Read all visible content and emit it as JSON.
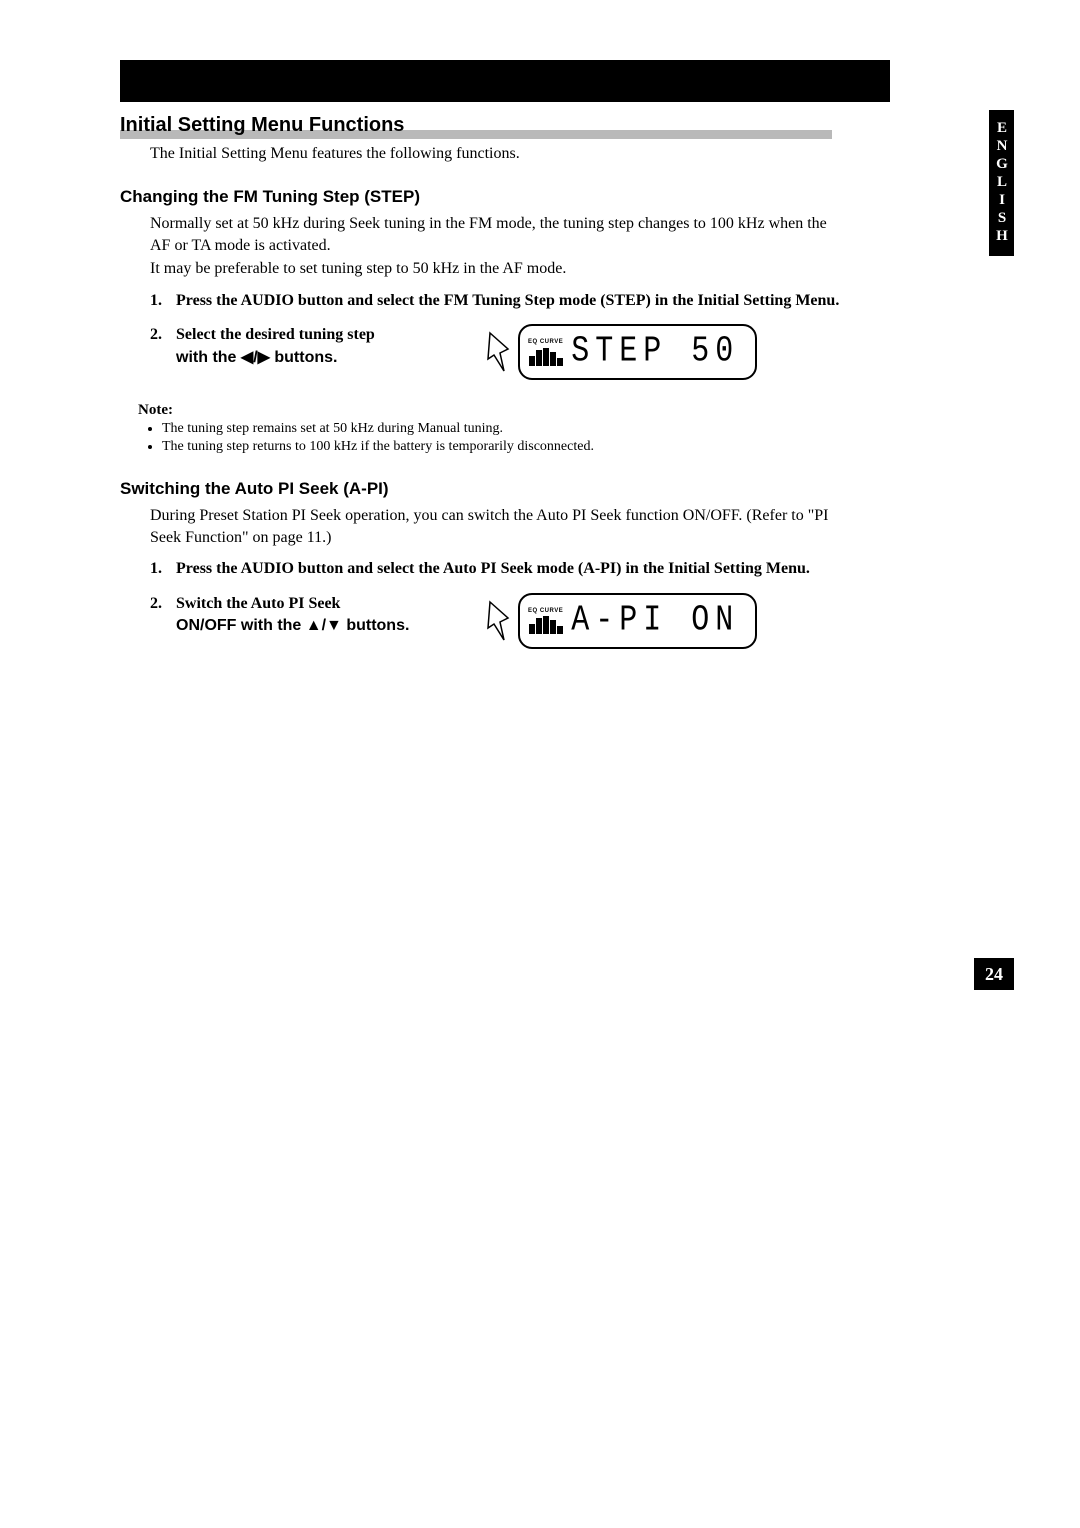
{
  "side_tab": "ENGLISH",
  "page_number": "24",
  "section_title": "Initial Setting Menu Functions",
  "intro": "The Initial Setting Menu features the following functions.",
  "fm": {
    "heading": "Changing the FM Tuning Step (STEP)",
    "para1": "Normally set at 50 kHz during Seek tuning in the FM mode, the tuning step changes to 100 kHz when the AF or TA mode is activated.",
    "para2": "It may be preferable to set tuning step to 50 kHz in the AF mode.",
    "step1": "Press the AUDIO button and select the FM Tuning Step mode (STEP) in the Initial Setting Menu.",
    "step2a": "Select the desired tuning step",
    "step2b": "with the ◀/▶ buttons.",
    "lcd_eq_label": "EQ CURVE",
    "lcd_text": "STEP  50",
    "note_head": "Note:",
    "note1": "The tuning step remains set at 50 kHz during Manual tuning.",
    "note2": "The tuning step returns to 100 kHz if the battery is temporarily disconnected."
  },
  "api": {
    "heading": "Switching the Auto PI Seek (A-PI)",
    "para1": "During Preset Station PI Seek operation, you can switch the Auto PI Seek function ON/OFF. (Refer to \"PI Seek Function\" on page 11.)",
    "step1": "Press the AUDIO button and select the Auto PI Seek mode (A-PI) in the Initial Setting Menu.",
    "step2a": "Switch the Auto PI Seek",
    "step2b": "ON/OFF with the ▲/▼ buttons.",
    "lcd_eq_label": "EQ CURVE",
    "lcd_text": "A-PI  ON"
  }
}
